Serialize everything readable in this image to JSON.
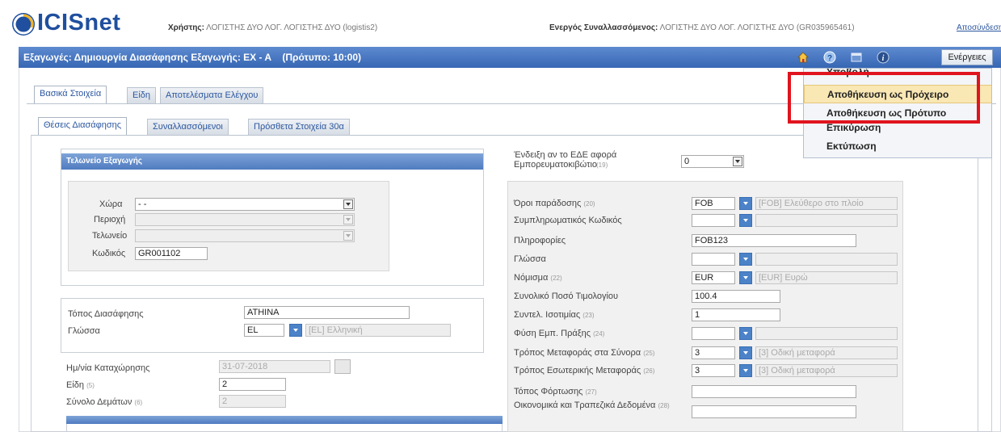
{
  "header": {
    "logo_text": "ICISnet",
    "user_label": "Χρήστης:",
    "user_value": "ΛΟΓΙΣΤΗΣ ΔΥΟ ΛΟΓ. ΛΟΓΙΣΤΗΣ ΔΥΟ (logistis2)",
    "trader_label": "Ενεργός Συναλλασσόμενος:",
    "trader_value": "ΛΟΓΙΣΤΗΣ ΔΥΟ ΛΟΓ. ΛΟΓΙΣΤΗΣ ΔΥΟ (GR035965461)",
    "logout": "Αποσύνδεση"
  },
  "titlebar": {
    "title": "Εξαγωγές: Δημιουργία Διασάφησης Εξαγωγής: ΕΧ - Α    (Πρότυπο: 10:00)",
    "actions_button": "Ενέργειες"
  },
  "actions_menu": {
    "items": [
      "Υποβολή",
      "Αποθήκευση ως Πρόχειρο",
      "Αποθήκευση ως Πρότυπο",
      "Επικύρωση",
      "Εκτύπωση"
    ]
  },
  "tabs_main": [
    "Βασικά Στοιχεία",
    "Είδη",
    "Αποτελέσματα Ελέγχου"
  ],
  "tabs_sub": [
    "Θέσεις Διασάφησης",
    "Συναλλασσόμενοι",
    "Πρόσθετα Στοιχεία 30α"
  ],
  "customs": {
    "heading": "Τελωνείο Εξαγωγής",
    "country_label": "Χώρα",
    "country_value": "- -",
    "region_label": "Περιοχή",
    "office_label": "Τελωνείο",
    "code_label": "Κωδικός",
    "code_value": "GR001102"
  },
  "declaration": {
    "place_label": "Τόπος Διασάφησης",
    "place_value": "ATHINA",
    "language_label": "Γλώσσα",
    "language_code": "EL",
    "language_desc": "[EL] Ελληνική"
  },
  "registration": {
    "date_label": "Ημ/νία Καταχώρησης",
    "date_value": "31-07-2018",
    "items_label": "Είδη",
    "items_sub": "(5)",
    "items_value": "2",
    "packages_label": "Σύνολο Δεμάτων",
    "packages_sub": "(6)",
    "packages_value": "2"
  },
  "container": {
    "label": "Ένδειξη αν το ΕΔΕ αφορά Εμπορευματοκιβώτιο",
    "sub": "(19)",
    "value": "0"
  },
  "right_fields": [
    {
      "label": "Όροι παράδοσης",
      "sub": "(20)",
      "code": "FOB",
      "desc": "[FOB] Ελεύθερο στο πλοίο"
    },
    {
      "label": "Συμπληρωματικός Κωδικός",
      "sub": "",
      "code": "",
      "desc": ""
    },
    {
      "label": "Πληροφορίες",
      "sub": "",
      "value": "FOB123"
    },
    {
      "label": "Γλώσσα",
      "sub": "",
      "code": "",
      "desc": ""
    },
    {
      "label": "Νόμισμα",
      "sub": "(22)",
      "code": "EUR",
      "desc": "[EUR] Ευρώ"
    },
    {
      "label": "Συνολικό Ποσό Τιμολογίου",
      "sub": "",
      "value": "100.4"
    },
    {
      "label": "Συντελ. Ισοτιμίας",
      "sub": "(23)",
      "value": "1"
    },
    {
      "label": "Φύση Εμπ. Πράξης",
      "sub": "(24)",
      "code": "",
      "desc": ""
    },
    {
      "label": "Τρόπος Μεταφοράς στα Σύνορα",
      "sub": "(25)",
      "code": "3",
      "desc": "[3] Οδική μεταφορά"
    },
    {
      "label": "Τρόπος Εσωτερικής Μεταφοράς",
      "sub": "(26)",
      "code": "3",
      "desc": "[3] Οδική μεταφορά"
    },
    {
      "label": "Τόπος Φόρτωσης",
      "sub": "(27)",
      "value": ""
    },
    {
      "label": "Οικονομικά και Τραπεζικά Δεδομένα",
      "sub": "(28)",
      "value": ""
    }
  ],
  "colors": {
    "titlebar": "#3f6fb8",
    "highlight_box": "#e0141e",
    "menu_selected": "#f9e7b4"
  }
}
